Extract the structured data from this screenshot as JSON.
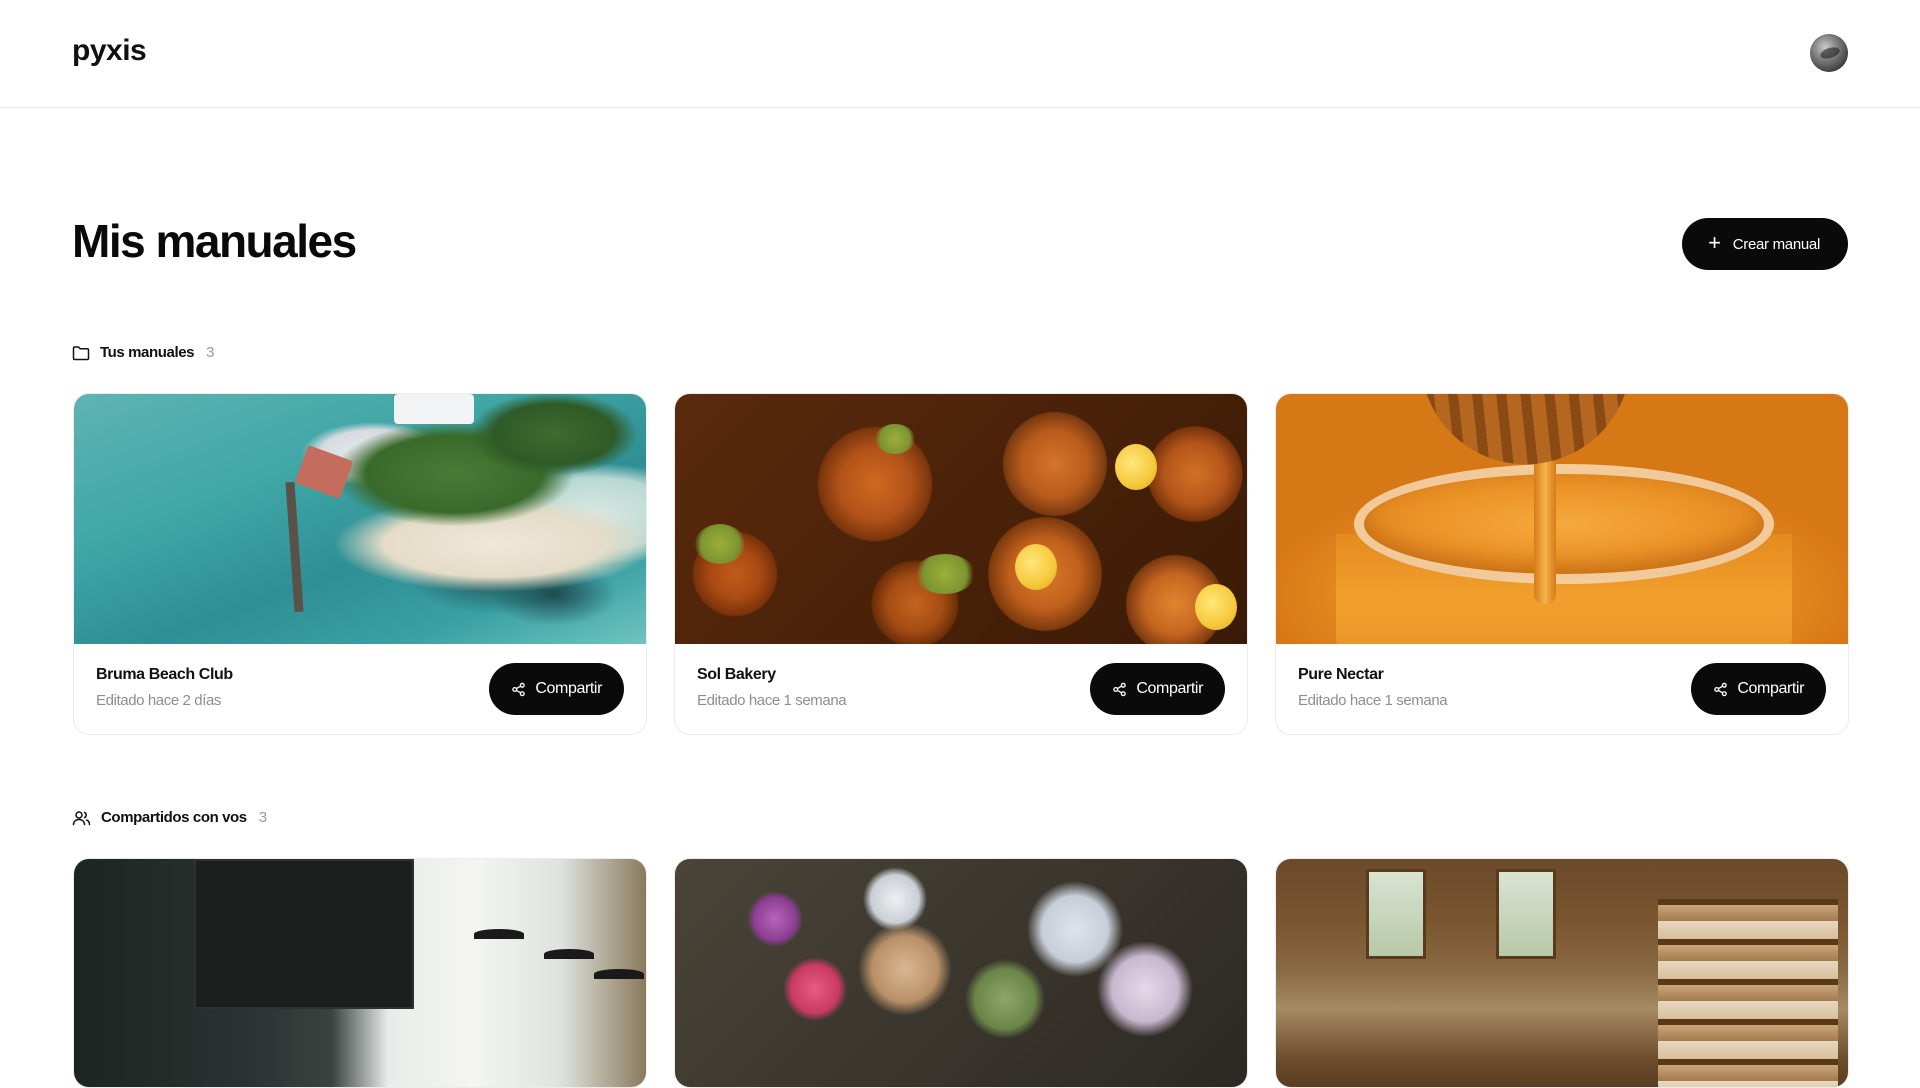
{
  "app": {
    "logo": "pyxis"
  },
  "page": {
    "title": "Mis manuales",
    "create_label": "Crear manual"
  },
  "sections": {
    "own": {
      "label": "Tus manuales",
      "count": "3",
      "cards": [
        {
          "name": "Bruma Beach Club",
          "edited": "Editado hace 2 días",
          "share_label": "Compartir",
          "image": "aerial-beach-club"
        },
        {
          "name": "Sol Bakery",
          "edited": "Editado hace 1 semana",
          "share_label": "Compartir",
          "image": "pastries"
        },
        {
          "name": "Pure Nectar",
          "edited": "Editado hace 1 semana",
          "share_label": "Compartir",
          "image": "honey-jar"
        }
      ]
    },
    "shared": {
      "label": "Compartidos con vos",
      "count": "3",
      "cards": [
        {
          "image": "cafe-interior"
        },
        {
          "image": "flower-bouquets"
        },
        {
          "image": "antique-bookshop"
        }
      ]
    }
  },
  "icons": {
    "own_section": "folder-icon",
    "shared_section": "users-icon",
    "create": "plus-icon",
    "share": "share-icon"
  },
  "colors": {
    "primary": "#0a0a0a",
    "muted_text": "#8e8e8e",
    "border": "#ececec"
  }
}
